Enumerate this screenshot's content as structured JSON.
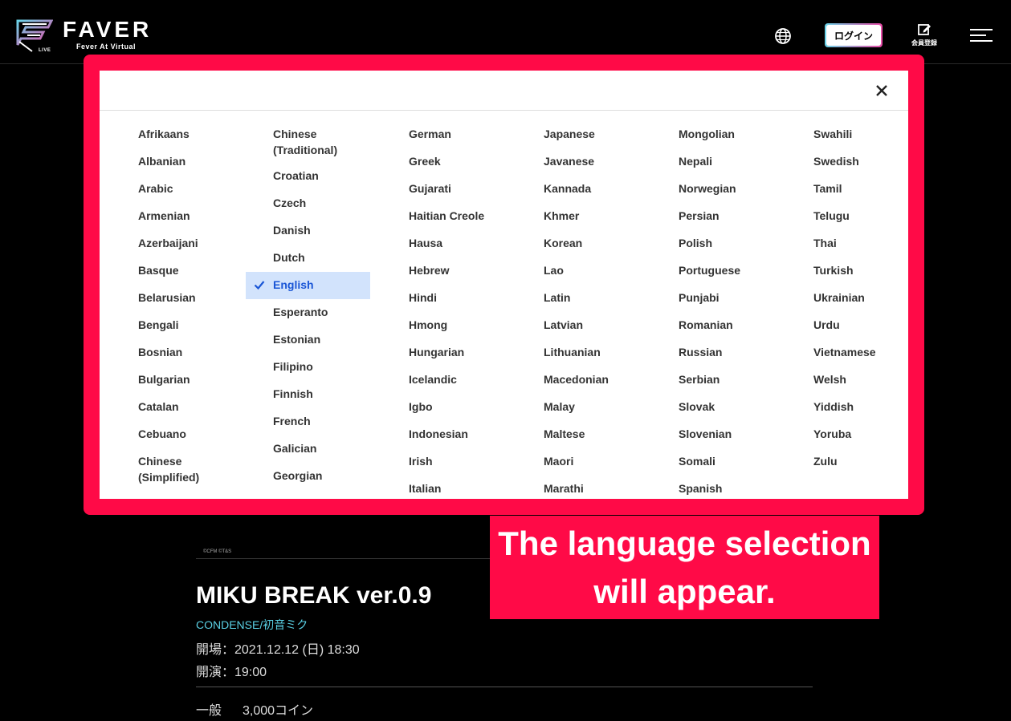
{
  "header": {
    "logo_word": "FAVER",
    "logo_sub": "Fever At Virtual",
    "logo_tag": "LIVE",
    "login_label": "ログイン",
    "register_label": "会員登録",
    "icons": [
      "globe-icon",
      "edit-icon",
      "hamburger-icon"
    ]
  },
  "event": {
    "copyright": "©CFM ©T&S",
    "title": "MIKU BREAK ver.0.9",
    "artist": "CONDENSE/初音ミク",
    "open": "開場：2021.12.12 (日) 18:30",
    "start": "開演：19:00",
    "price_label": "一般",
    "price_value": "3,000コイン"
  },
  "language_panel": {
    "selected": "English",
    "columns": [
      [
        "Afrikaans",
        "Albanian",
        "Arabic",
        "Armenian",
        "Azerbaijani",
        "Basque",
        "Belarusian",
        "Bengali",
        "Bosnian",
        "Bulgarian",
        "Catalan",
        "Cebuano",
        "Chinese (Simplified)"
      ],
      [
        "Chinese (Traditional)",
        "Croatian",
        "Czech",
        "Danish",
        "Dutch",
        "English",
        "Esperanto",
        "Estonian",
        "Filipino",
        "Finnish",
        "French",
        "Galician",
        "Georgian"
      ],
      [
        "German",
        "Greek",
        "Gujarati",
        "Haitian Creole",
        "Hausa",
        "Hebrew",
        "Hindi",
        "Hmong",
        "Hungarian",
        "Icelandic",
        "Igbo",
        "Indonesian",
        "Irish",
        "Italian"
      ],
      [
        "Japanese",
        "Javanese",
        "Kannada",
        "Khmer",
        "Korean",
        "Lao",
        "Latin",
        "Latvian",
        "Lithuanian",
        "Macedonian",
        "Malay",
        "Maltese",
        "Maori",
        "Marathi"
      ],
      [
        "Mongolian",
        "Nepali",
        "Norwegian",
        "Persian",
        "Polish",
        "Portuguese",
        "Punjabi",
        "Romanian",
        "Russian",
        "Serbian",
        "Slovak",
        "Slovenian",
        "Somali",
        "Spanish"
      ],
      [
        "Swahili",
        "Swedish",
        "Tamil",
        "Telugu",
        "Thai",
        "Turkish",
        "Ukrainian",
        "Urdu",
        "Vietnamese",
        "Welsh",
        "Yiddish",
        "Yoruba",
        "Zulu"
      ]
    ]
  },
  "callout": {
    "line1": "The language selection",
    "line2": "will appear."
  },
  "colors": {
    "highlight": "#ff0a47",
    "selected_bg": "#d2e3fc",
    "selected_text": "#1a56d6",
    "artist": "#5ad0e4"
  }
}
